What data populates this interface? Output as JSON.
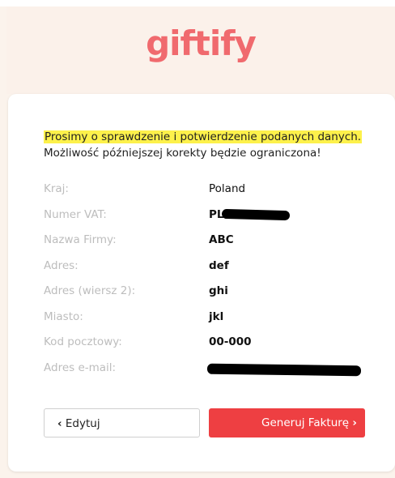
{
  "brand": {
    "logo_text": "giftify",
    "logo_color": "#f06a6e"
  },
  "notice": {
    "title": "Prosimy o sprawdzenie i potwierdzenie podanych danych.",
    "subtitle": "Możliwość późniejszej korekty będzie ograniczona!"
  },
  "fields": [
    {
      "label": "Kraj:",
      "value": "Poland"
    },
    {
      "label": "Numer VAT:",
      "value": "PL"
    },
    {
      "label": "Nazwa Firmy:",
      "value": "ABC"
    },
    {
      "label": "Adres:",
      "value": "def"
    },
    {
      "label": "Adres (wiersz 2):",
      "value": "ghi"
    },
    {
      "label": "Miasto:",
      "value": "jkl"
    },
    {
      "label": "Kod pocztowy:",
      "value": "00-000"
    },
    {
      "label": "Adres e-mail:",
      "value": ""
    }
  ],
  "buttons": {
    "edit_label": "Edytuj",
    "generate_label": "Generuj Fakturę",
    "chevron_left": "‹",
    "chevron_right": "›",
    "generate_color": "#ee3f42"
  }
}
